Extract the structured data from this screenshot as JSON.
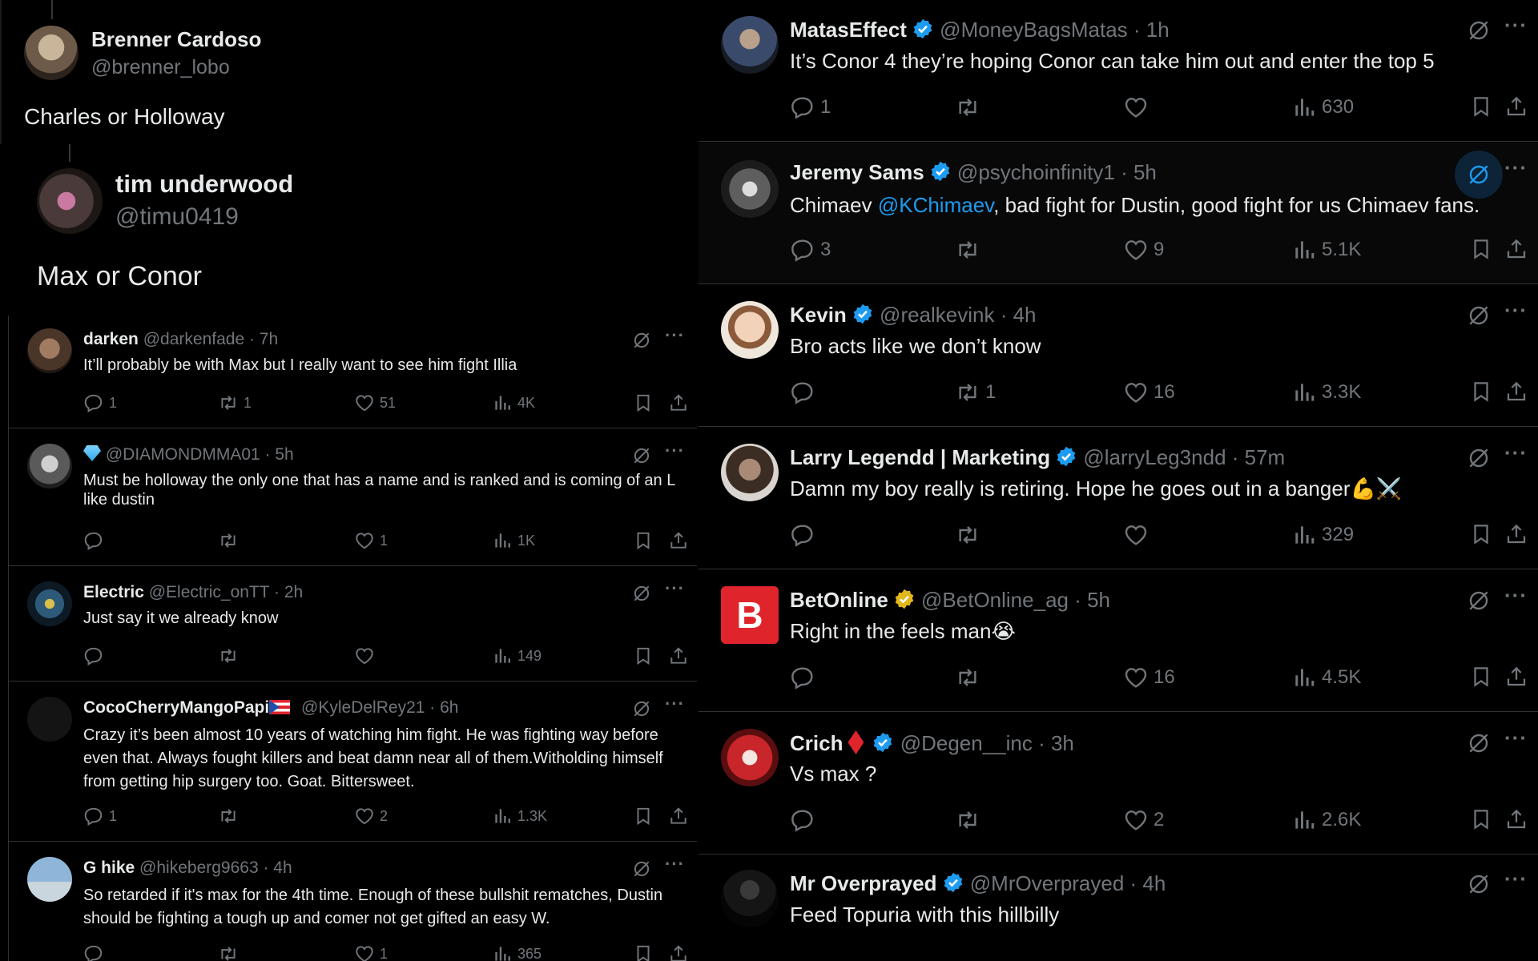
{
  "left": {
    "main1": {
      "name": "Brenner Cardoso",
      "handle": "@brenner_lobo",
      "text": "Charles or Holloway"
    },
    "main2": {
      "name": "tim underwood",
      "handle": "@timu0419",
      "text": "Max or Conor"
    },
    "replies": [
      {
        "name": "darken",
        "meta": "@darkenfade · 7h",
        "text": "It’ll probably be with Max but I really want to see him fight Illia",
        "replies": "1",
        "reposts": "1",
        "likes": "51",
        "views": "4K"
      },
      {
        "name": "",
        "meta": "@DIAMONDMMA01 · 5h",
        "text": "Must be holloway the only one that has a name and is ranked and is coming of an L like dustin",
        "replies": "",
        "reposts": "",
        "likes": "1",
        "views": "1K"
      },
      {
        "name": "Electric",
        "meta": "@Electric_onTT · 2h",
        "text": "Just say it we already know",
        "replies": "",
        "reposts": "",
        "likes": "",
        "views": "149"
      },
      {
        "name": "CocoCherryMangoPapi",
        "meta": "@KyleDelRey21 · 6h",
        "text": "Crazy it’s been almost 10 years of watching him fight. He was fighting way before even that. Always fought killers and beat damn near all of them.Witholding himself from getting hip surgery too. Goat. Bittersweet.",
        "replies": "1",
        "reposts": "",
        "likes": "2",
        "views": "1.3K"
      },
      {
        "name": "G hike",
        "meta": "@hikeberg9663 · 4h",
        "text": "So retarded if it's max for the 4th time. Enough of these bullshit rematches, Dustin should be fighting a tough up and comer not get gifted an easy W.",
        "replies": "",
        "reposts": "",
        "likes": "1",
        "views": "365"
      }
    ]
  },
  "right": {
    "replies": [
      {
        "name": "MatasEffect",
        "meta": "@MoneyBagsMatas · 1h",
        "text": "It’s Conor 4 they’re hoping Conor can take him out and enter the top 5",
        "replies": "1",
        "reposts": "",
        "likes": "",
        "views": "630"
      },
      {
        "name": "Jeremy Sams",
        "meta": "@psychoinfinity1 · 5h",
        "text_pre": "Chimaev ",
        "mention": "@KChimaev",
        "text_post": ", bad fight for Dustin, good fight for us Chimaev fans.",
        "replies": "3",
        "reposts": "",
        "likes": "9",
        "views": "5.1K"
      },
      {
        "name": "Kevin",
        "meta": "@realkevink · 4h",
        "text": "Bro acts like we don’t know",
        "replies": "",
        "reposts": "1",
        "likes": "16",
        "views": "3.3K"
      },
      {
        "name": "Larry Legendd | Marketing",
        "meta": "@larryLeg3ndd · 57m",
        "text": "Damn my boy really is retiring. Hope he goes out in a banger💪⚔️",
        "replies": "",
        "reposts": "",
        "likes": "",
        "views": "329"
      },
      {
        "name": "BetOnline",
        "meta": "@BetOnline_ag · 5h",
        "text": "Right in the feels man😭",
        "replies": "",
        "reposts": "",
        "likes": "16",
        "views": "4.5K",
        "logo_letter": "B"
      },
      {
        "name": "Crich",
        "meta": "@Degen__inc · 3h",
        "text": "Vs max ?",
        "replies": "",
        "reposts": "",
        "likes": "2",
        "views": "2.6K"
      },
      {
        "name": "Mr Overprayed",
        "meta": "@MrOverprayed · 4h",
        "text": "Feed Topuria with this hillbilly",
        "replies": "",
        "reposts": "",
        "likes": "",
        "views": ""
      }
    ]
  },
  "colors": {
    "background": "#000000",
    "text": "#e7e9ea",
    "muted": "#71767b",
    "link": "#1d9bf0",
    "verified_blue": "#1d9bf0",
    "verified_gold": "#e2b719",
    "divider": "#2f3336",
    "betonline_red": "#e0242c",
    "gem": "#2da8e6",
    "crich_diamond": "#e0242c"
  },
  "icons": [
    "reply-icon",
    "repost-icon",
    "like-icon",
    "views-icon",
    "bookmark-icon",
    "share-icon",
    "grok-icon",
    "more-icon",
    "verified-badge-icon",
    "diamond-emoji",
    "flag-emoji"
  ]
}
